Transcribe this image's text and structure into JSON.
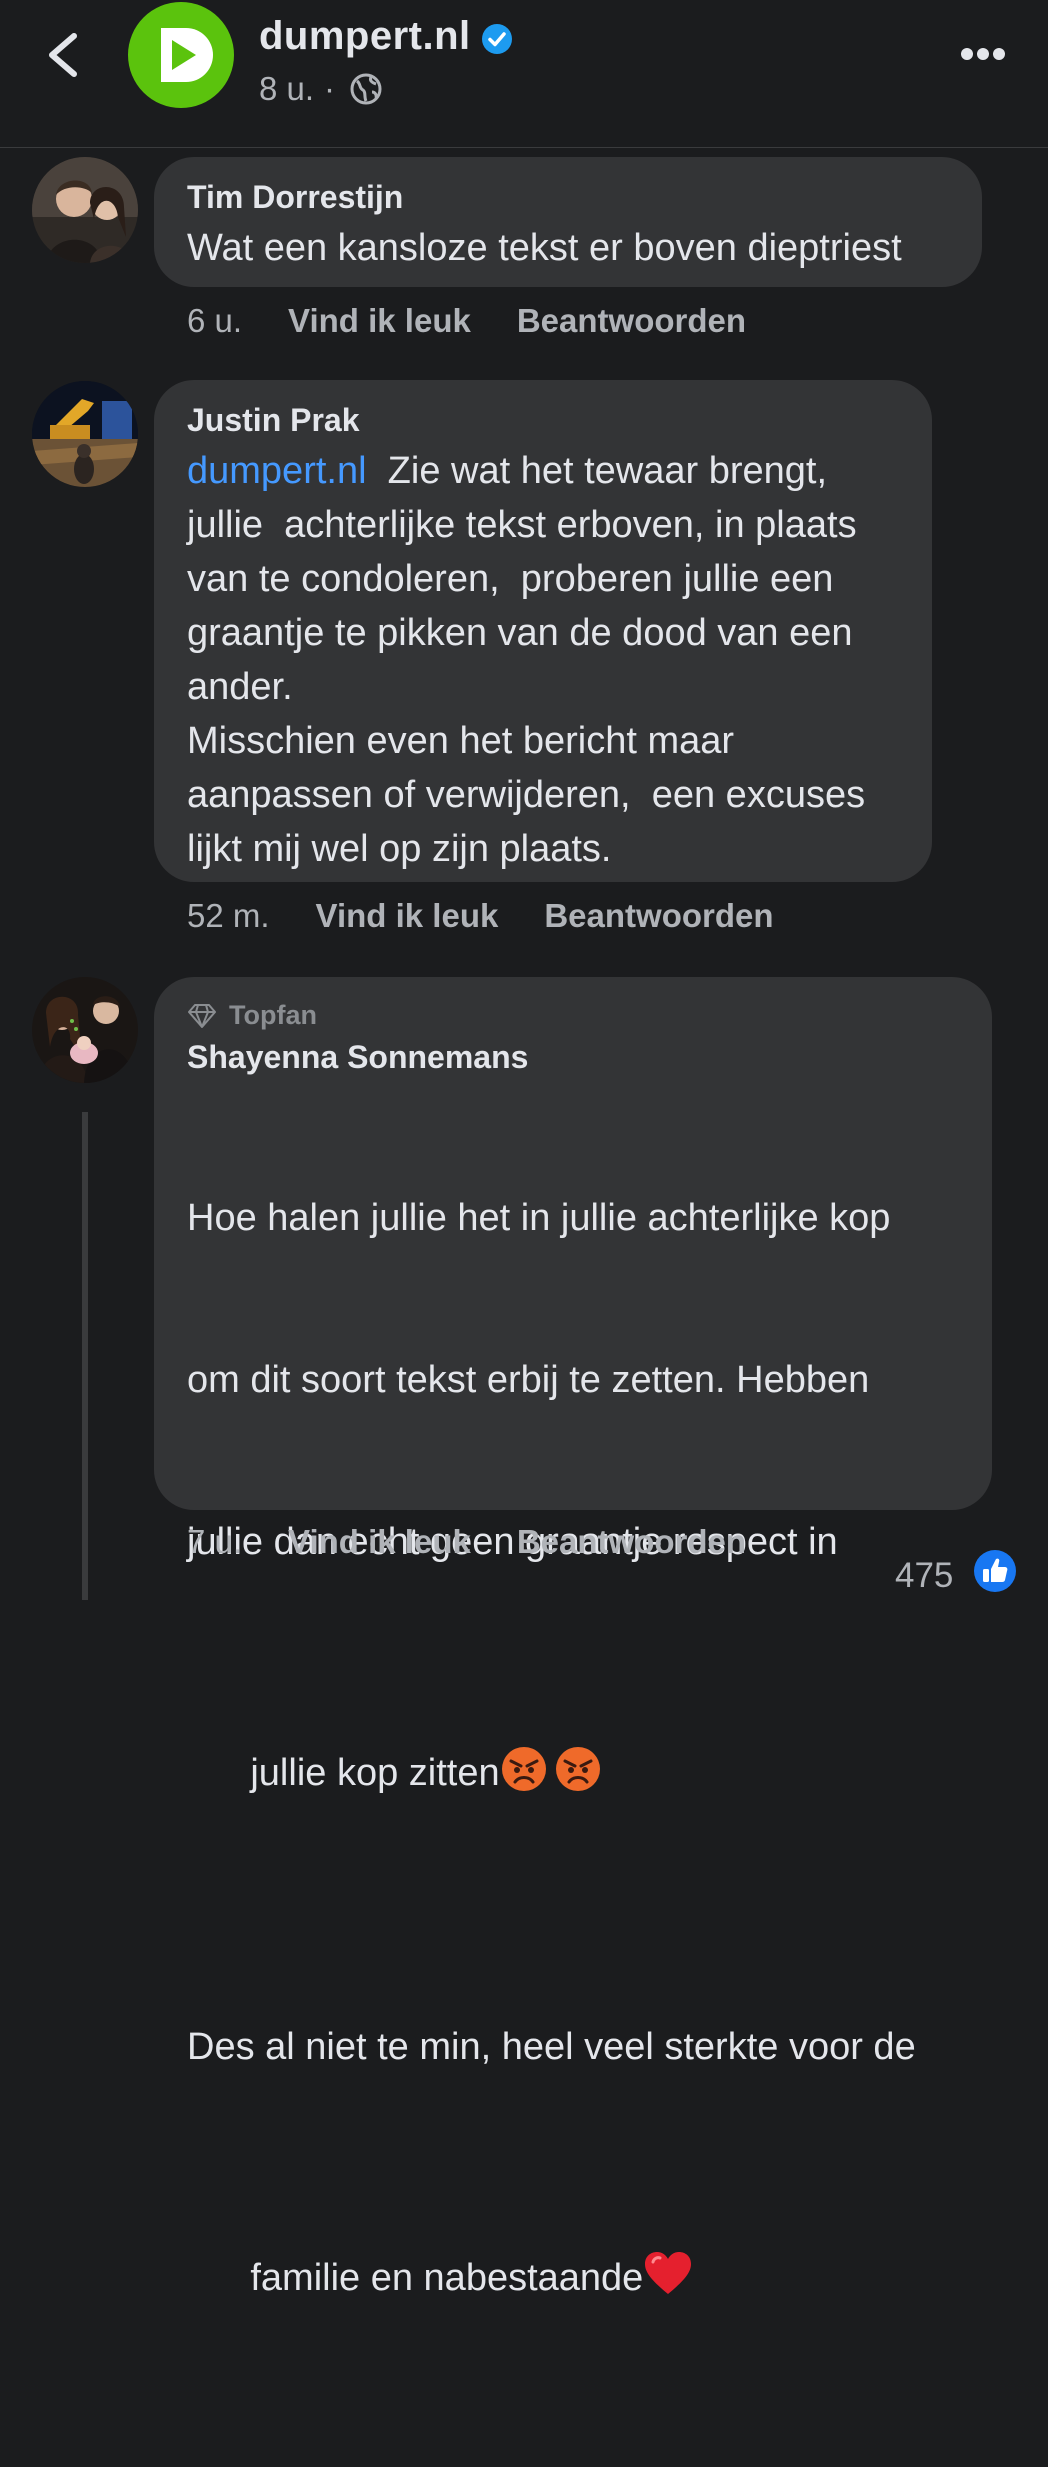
{
  "header": {
    "page_name": "dumpert.nl",
    "time": "8 u.",
    "separator": "·"
  },
  "comments": [
    {
      "author": "Tim Dorrestijn",
      "text": "Wat een kansloze tekst er boven dieptriest",
      "time": "6 u.",
      "like_label": "Vind ik leuk",
      "reply_label": "Beantwoorden"
    },
    {
      "author": "Justin Prak",
      "mention": "dumpert.nl",
      "text_lines": [
        "  Zie wat het tewaar brengt,",
        "jullie  achterlijke tekst erboven, in plaats",
        "van te condoleren,  proberen jullie een",
        "graantje te pikken van de dood van een",
        "ander.",
        "Misschien even het bericht maar",
        "aanpassen of verwijderen,  een excuses",
        "lijkt mij wel op zijn plaats."
      ],
      "time": "52 m.",
      "like_label": "Vind ik leuk",
      "reply_label": "Beantwoorden"
    },
    {
      "badge": "Topfan",
      "author": "Shayenna Sonnemans",
      "text_lines": [
        "Hoe halen jullie het in jullie achterlijke kop",
        "om dit soort tekst erbij te zetten. Hebben",
        "jullie dan echt geen graantje respect in",
        "jullie kop zitten",
        "Des al niet te min, heel veel sterkte voor de",
        "familie en nabestaande"
      ],
      "time": "7 u.",
      "like_label": "Vind ik leuk",
      "reply_label": "Beantwoorden",
      "reaction_count": "475"
    }
  ],
  "colors": {
    "background": "#1b1c1e",
    "bubble": "#333436",
    "link": "#4599ff",
    "logo_green": "#5bc30d",
    "verified_blue": "#1d9bf0"
  }
}
